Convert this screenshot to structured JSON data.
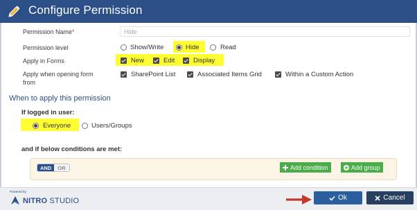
{
  "dialog": {
    "title": "Configure Permission"
  },
  "form": {
    "permission_name": {
      "label": "Permission Name",
      "required_marker": "*",
      "value": "Hide"
    },
    "permission_level": {
      "label": "Permission level",
      "options": [
        "Show/Write",
        "Hide",
        "Read"
      ],
      "selected": "Hide"
    },
    "apply_in_forms": {
      "label": "Apply in Forms",
      "options": [
        {
          "label": "New",
          "checked": true
        },
        {
          "label": "Edit",
          "checked": true
        },
        {
          "label": "Display",
          "checked": true
        }
      ]
    },
    "apply_when_opening": {
      "label_line1": "Apply when opening form",
      "label_line2": "from",
      "options": [
        {
          "label": "SharePoint List",
          "checked": true
        },
        {
          "label": "Associated Items Grid",
          "checked": true
        },
        {
          "label": "Within a Custom Action",
          "checked": true
        }
      ]
    }
  },
  "when_section": {
    "heading": "When to apply this permission",
    "logged_in_label": "If logged in user:",
    "user_options": [
      "Everyone",
      "Users/Groups"
    ],
    "selected_user_option": "Everyone",
    "conditions_label": "and if below conditions are met:",
    "logic_toggle": {
      "and": "AND",
      "or": "OR",
      "selected": "AND"
    },
    "add_condition_label": "Add condition",
    "add_group_label": "Add group"
  },
  "footer": {
    "powered_by": "Powered by",
    "brand_bold": "NITRO",
    "brand_regular": "STUDIO",
    "ok_label": "Ok",
    "cancel_label": "Cancel"
  },
  "colors": {
    "header": "#2b4f86",
    "highlight": "#fdfd32",
    "green_button": "#4bac4c",
    "ok_button": "#2b5e9c",
    "cancel_button": "#27405f",
    "annotation_arrow": "#c0392b"
  }
}
